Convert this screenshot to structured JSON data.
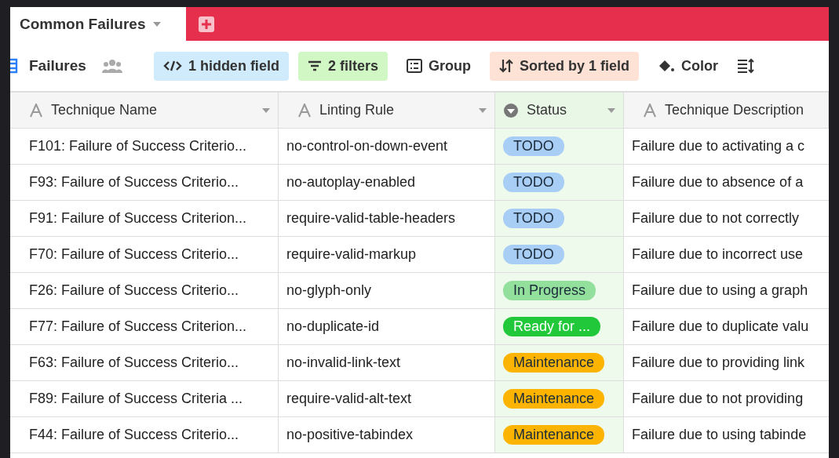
{
  "tabs": [
    {
      "label": "Common Failures",
      "selected": true
    }
  ],
  "view": {
    "name": "Failures"
  },
  "toolbar": [
    {
      "kind": "hidden",
      "label": "1 hidden field",
      "active": true
    },
    {
      "kind": "filter",
      "label": "2 filters",
      "active": true
    },
    {
      "kind": "group",
      "label": "Group",
      "active": false
    },
    {
      "kind": "sort",
      "label": "Sorted by 1 field",
      "active": true
    },
    {
      "kind": "color",
      "label": "Color",
      "active": false
    }
  ],
  "table": {
    "columns": [
      {
        "label": "Technique Name",
        "kind": "text"
      },
      {
        "label": "Linting Rule",
        "kind": "text"
      },
      {
        "label": "Status",
        "kind": "select"
      },
      {
        "label": "Technique Description",
        "kind": "text"
      }
    ],
    "rows": [
      {
        "name": "F101: Failure of Success Criterio...",
        "rule": "no-control-on-down-event",
        "status": "TODO",
        "color": "#a9cef6",
        "description": "Failure due to activating a c"
      },
      {
        "name": "F93: Failure of Success Criterio...",
        "rule": "no-autoplay-enabled",
        "status": "TODO",
        "color": "#a9cef6",
        "description": "Failure due to absence of a"
      },
      {
        "name": "F91: Failure of Success Criterion...",
        "rule": "require-valid-table-headers",
        "status": "TODO",
        "color": "#a9cef6",
        "description": "Failure due to not correctly"
      },
      {
        "name": "F70: Failure of Success Criterio...",
        "rule": "require-valid-markup",
        "status": "TODO",
        "color": "#a9cef6",
        "description": "Failure due to incorrect use"
      },
      {
        "name": "F26: Failure of Success Criterio...",
        "rule": "no-glyph-only",
        "status": "In Progress",
        "color": "#93e09d",
        "description": "Failure due to using a graph"
      },
      {
        "name": "F77: Failure of Success Criterion...",
        "rule": "no-duplicate-id",
        "status": "Ready for ...",
        "color": "#21c83a",
        "description": "Failure due to duplicate valu"
      },
      {
        "name": "F63: Failure of Success Criterio...",
        "rule": "no-invalid-link-text",
        "status": "Maintenance",
        "color": "#fcb400",
        "description": "Failure due to providing link"
      },
      {
        "name": "F89: Failure of Success Criteria ...",
        "rule": "require-valid-alt-text",
        "status": "Maintenance",
        "color": "#fcb400",
        "description": "Failure due to not providing"
      },
      {
        "name": "F44: Failure of Success Criterio...",
        "rule": "no-positive-tabindex",
        "status": "Maintenance",
        "color": "#fcb400",
        "description": "Failure due to using tabinde"
      }
    ]
  }
}
